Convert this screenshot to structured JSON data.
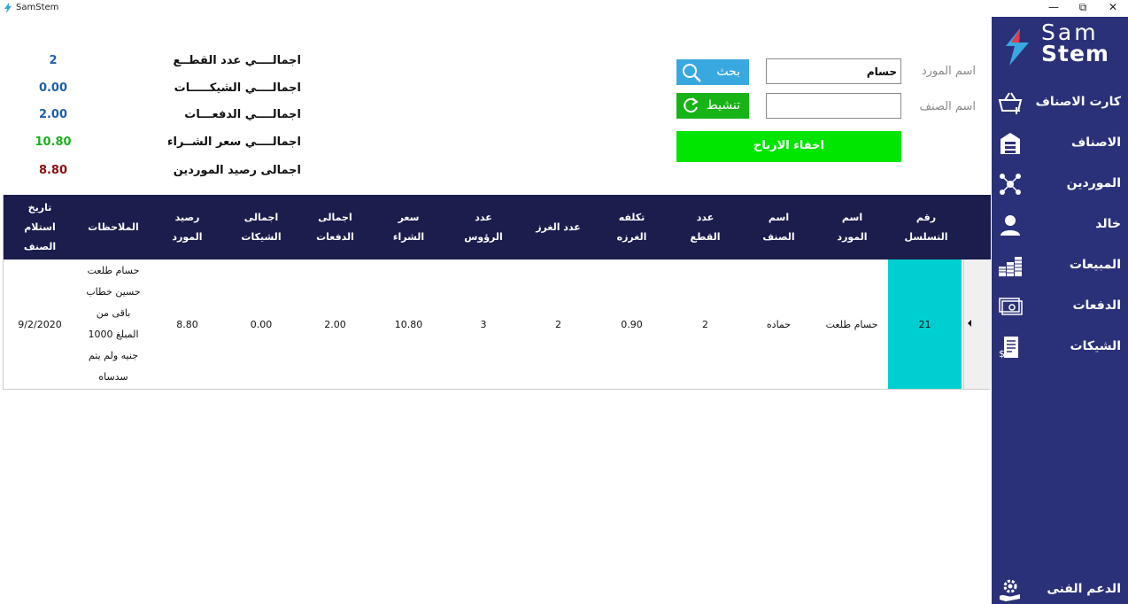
{
  "window": {
    "title": "SamStem",
    "minimize": "—",
    "restore": "⧉",
    "close": "✕"
  },
  "logo": {
    "line1": "Sam",
    "line2": "Stem"
  },
  "sidebar": {
    "items": [
      {
        "label": "كارت الاصناف",
        "icon": "basket-plus-icon"
      },
      {
        "label": "الاصناف",
        "icon": "warehouse-icon"
      },
      {
        "label": "الموردين",
        "icon": "network-icon"
      },
      {
        "label": "خالد",
        "icon": "user-icon"
      },
      {
        "label": "المبيعات",
        "icon": "coins-icon"
      },
      {
        "label": "الدفعات",
        "icon": "cash-icon"
      },
      {
        "label": "الشيكات",
        "icon": "receipt-icon"
      }
    ],
    "support": {
      "label": "الدعم الفنى",
      "icon": "support-icon"
    }
  },
  "summary": [
    {
      "label": "اجمالــــي عدد القطــع",
      "value": "2",
      "color": "#1f5fa8"
    },
    {
      "label": "اجمالــــي الشيكـــــات",
      "value": "0.00",
      "color": "#1f5fa8"
    },
    {
      "label": "اجمالــــي الدفعـــات",
      "value": "2.00",
      "color": "#1f5fa8"
    },
    {
      "label": "اجمالــــي سعر الشــراء",
      "value": "10.80",
      "color": "#1fae1f"
    },
    {
      "label": "اجمالى رصيد الموردين",
      "value": "8.80",
      "color": "#8b1010"
    }
  ],
  "search": {
    "supplier_label": "اسم المورد",
    "supplier_value": "حسام",
    "item_label": "اسم الصنف",
    "item_value": "",
    "search_button": "بحث",
    "refresh_button": "تنشيط",
    "hide_profits_button": "اخفاء الارباح"
  },
  "colors": {
    "sidebar_bg": "#2b3178",
    "table_header_bg": "#1b1d4d",
    "search_btn": "#3aa8e0",
    "refresh_btn": "#17b317",
    "hide_profits_btn": "#00e600",
    "serial_cell": "#00cfd1"
  },
  "table": {
    "columns": [
      "رقم\nالتسلسل",
      "اسم\nالمورد",
      "اسم\nالصنف",
      "عدد\nالقطع",
      "تكلفه\nالغرزه",
      "عدد الغرز",
      "عدد\nالرؤوس",
      "سعر\nالشراء",
      "اجمالى\nالدفعات",
      "اجمالى\nالشيكات",
      "رصيد\nالمورد",
      "الملاحظات",
      "تاريخ\nاستلام\nالصنف"
    ],
    "rows": [
      {
        "serial": "21",
        "supplier": "حسام طلعت",
        "item": "حماده",
        "pieces": "2",
        "stitch_cost": "0.90",
        "stitches": "2",
        "heads": "3",
        "purchase_price": "10.80",
        "total_payments": "2.00",
        "total_checks": "0.00",
        "supplier_balance": "8.80",
        "notes": "حسام طلعت حسين خطاب باقى من المبلغ 1000 جنيه ولم يتم سدساه",
        "received_date": "9/2/2020"
      }
    ]
  }
}
